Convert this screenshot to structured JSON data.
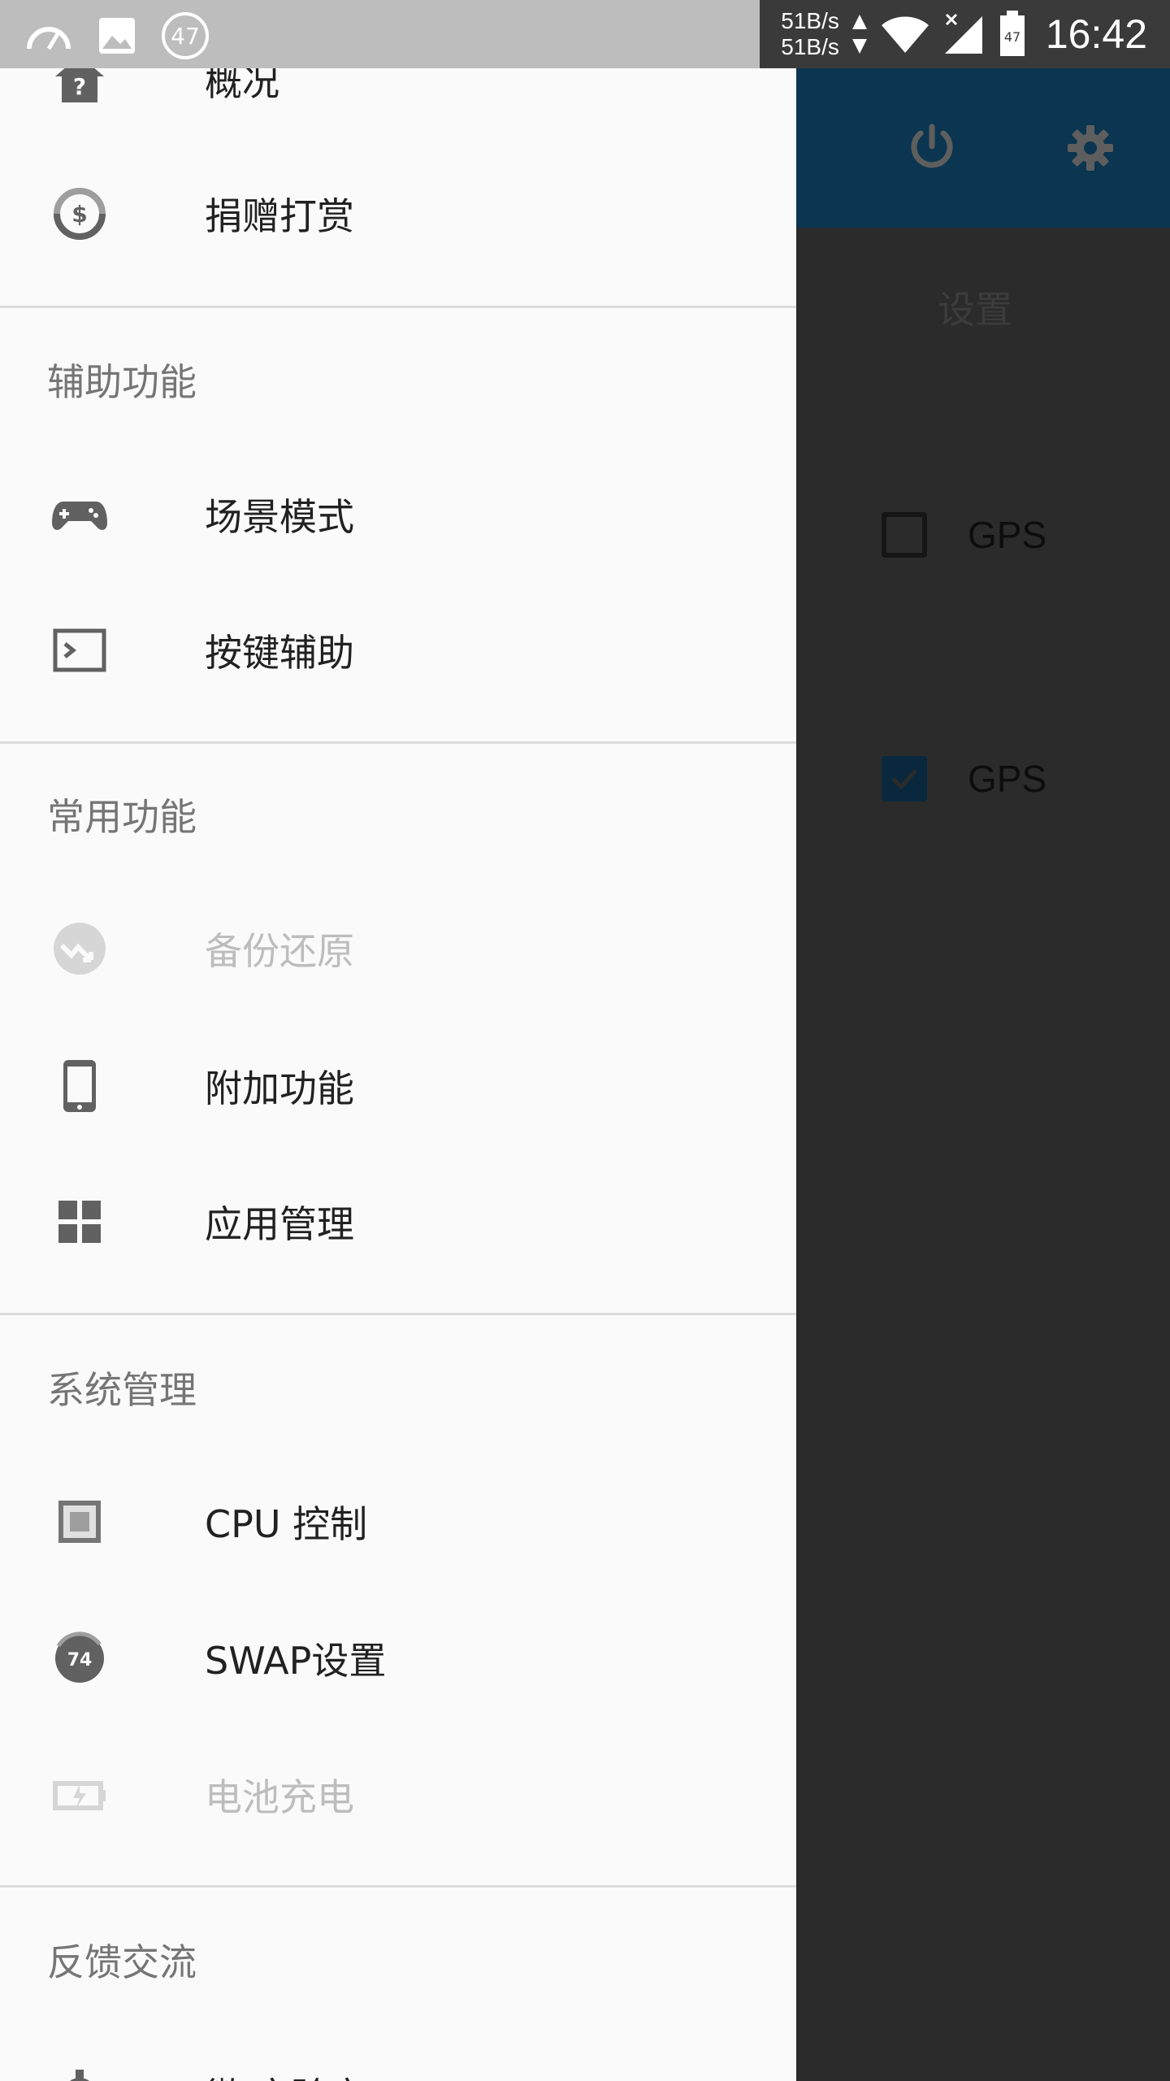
{
  "status_bar": {
    "speed_up": "51B/s",
    "speed_down": "51B/s",
    "notification_badge": "47",
    "battery_level": "47",
    "time": "16:42"
  },
  "background_app": {
    "toolbar_icons": [
      "power-icon",
      "gear-icon"
    ],
    "section_label": "设置",
    "rows": [
      {
        "label": "GPS",
        "checked": false
      },
      {
        "label": "GPS",
        "checked": true
      }
    ]
  },
  "drawer": {
    "top_items": [
      {
        "label": "概况",
        "icon": "home-help-icon",
        "disabled": false
      },
      {
        "label": "捐赠打赏",
        "icon": "donate-coin-icon",
        "disabled": false
      }
    ],
    "sections": [
      {
        "title": "辅助功能",
        "items": [
          {
            "label": "场景模式",
            "icon": "gamepad-icon",
            "disabled": false
          },
          {
            "label": "按键辅助",
            "icon": "terminal-icon",
            "disabled": false
          }
        ]
      },
      {
        "title": "常用功能",
        "items": [
          {
            "label": "备份还原",
            "icon": "backup-restore-icon",
            "disabled": true
          },
          {
            "label": "附加功能",
            "icon": "phone-icon",
            "disabled": false
          },
          {
            "label": "应用管理",
            "icon": "apps-grid-icon",
            "disabled": false
          }
        ]
      },
      {
        "title": "系统管理",
        "items": [
          {
            "label": "CPU 控制",
            "icon": "cpu-chip-icon",
            "disabled": false
          },
          {
            "label": "SWAP设置",
            "icon": "swap-gauge-icon",
            "badge": "74",
            "disabled": false
          },
          {
            "label": "电池充电",
            "icon": "battery-charge-icon",
            "disabled": true
          }
        ]
      },
      {
        "title": "反馈交流",
        "items": [
          {
            "label": "微 实验室",
            "icon": "gear-bug-icon",
            "disabled": false
          }
        ]
      }
    ]
  },
  "colors": {
    "toolbar": "#0b3550",
    "drawer_bg": "#fafafa",
    "scrim_bg": "#2b2b2b",
    "icon": "#616161",
    "disabled": "#bdbdbd"
  }
}
